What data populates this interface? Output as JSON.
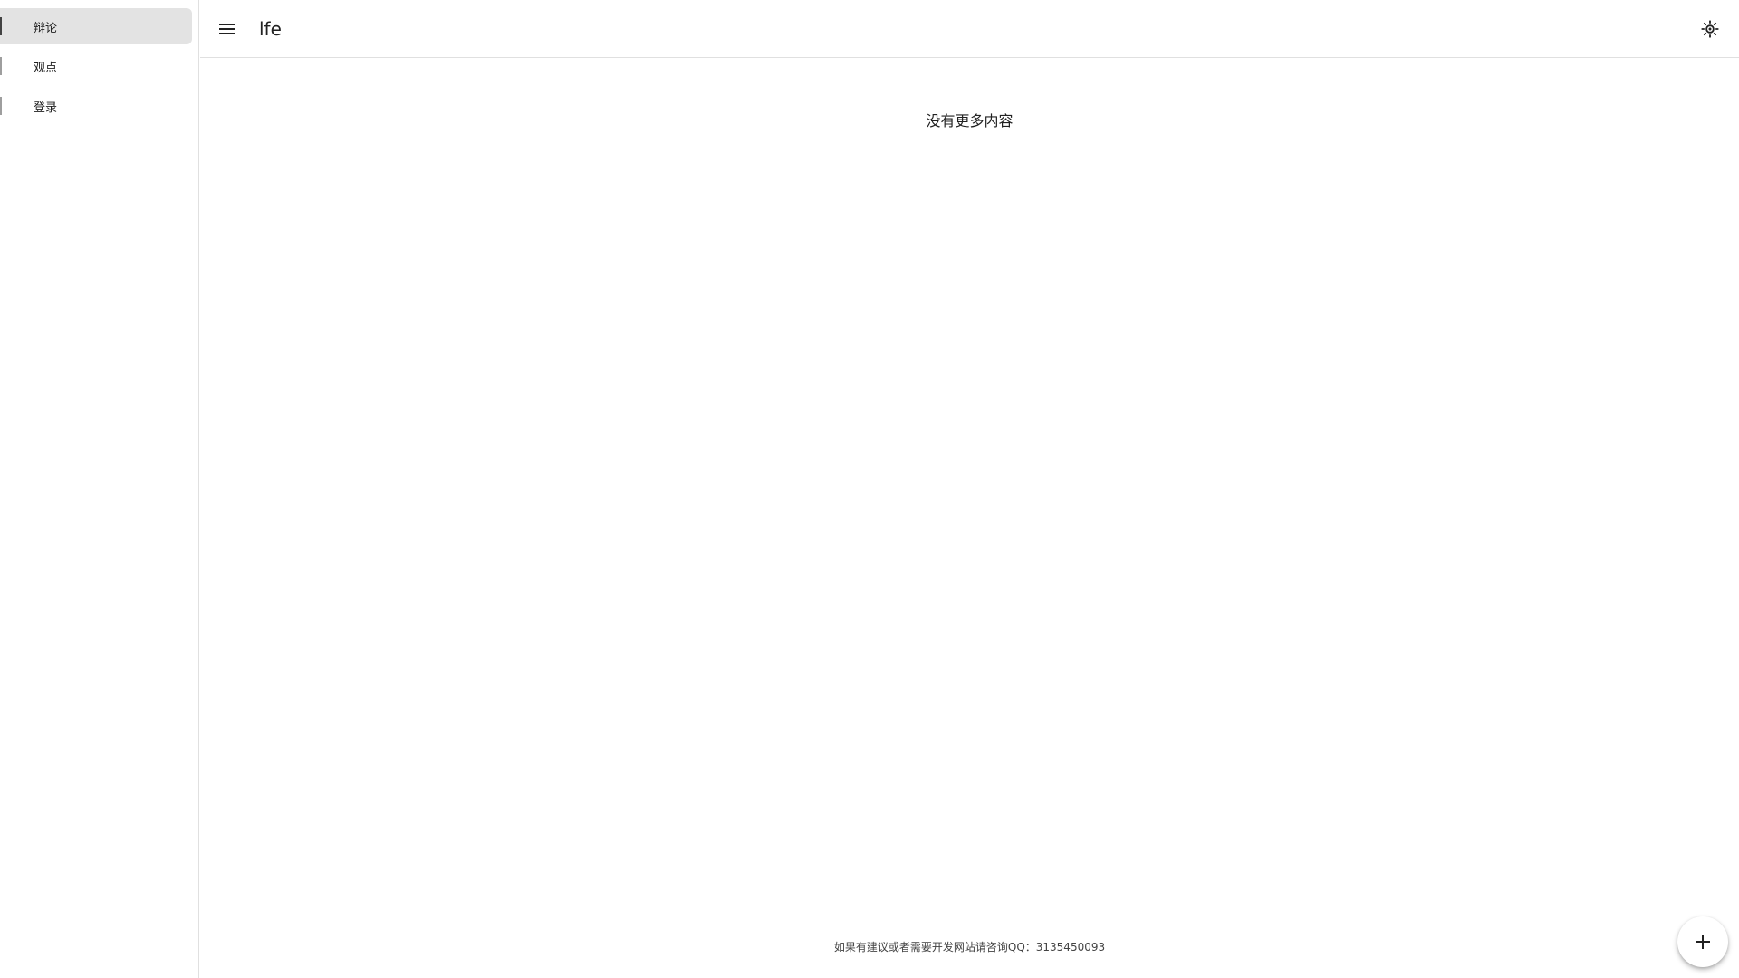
{
  "app": {
    "title": "lfe"
  },
  "sidebar": {
    "items": [
      {
        "label": "辩论",
        "active": true
      },
      {
        "label": "观点",
        "active": false
      },
      {
        "label": "登录",
        "active": false
      }
    ]
  },
  "topbar": {
    "menu_icon": "menu-icon",
    "theme_icon": "brightness-icon"
  },
  "main": {
    "empty_message": "没有更多内容"
  },
  "footer": {
    "note": "如果有建议或者需要开发网站请咨询QQ：3135450093"
  },
  "fab": {
    "icon": "plus-icon"
  }
}
